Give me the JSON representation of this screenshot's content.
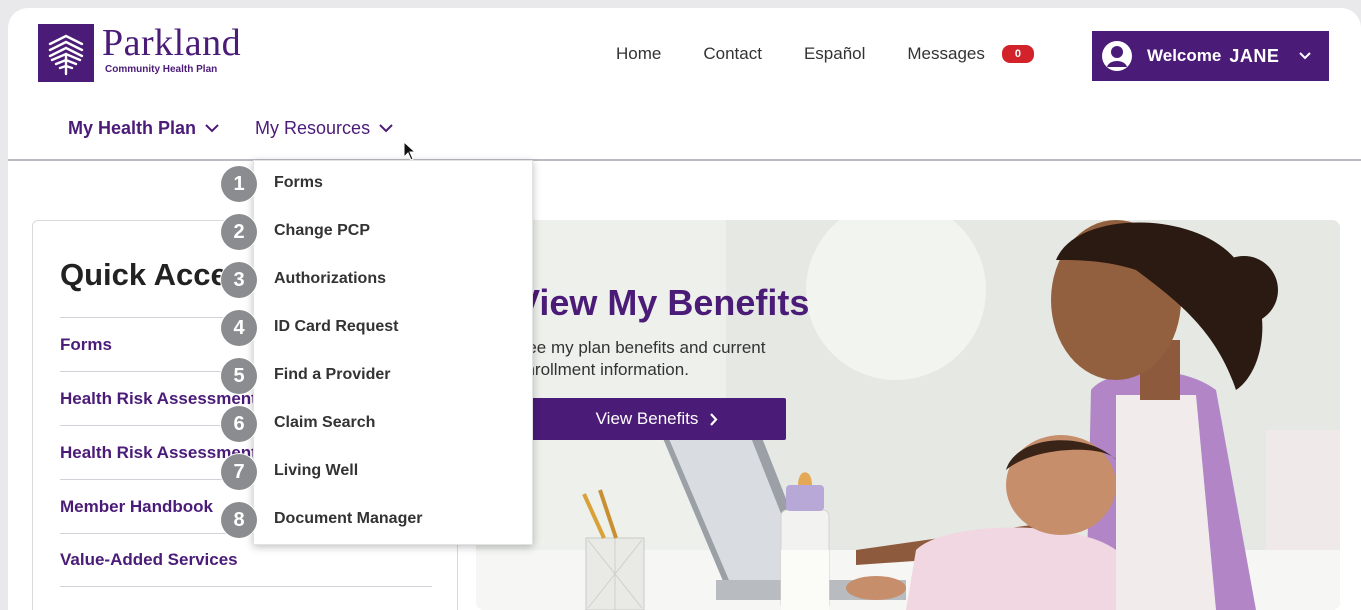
{
  "brand": {
    "name": "Parkland",
    "tagline": "Community Health Plan",
    "primary_color": "#4b1b78",
    "logo_icon": "parkland-logo-icon"
  },
  "topnav": {
    "home": "Home",
    "contact": "Contact",
    "espanol": "Español",
    "messages": "Messages",
    "messages_count": "0",
    "badge_color": "#d2232a"
  },
  "user": {
    "welcome_label": "Welcome",
    "name": "JANE",
    "avatar_icon": "user-avatar-icon"
  },
  "subnav": {
    "my_health_plan": "My Health Plan",
    "my_resources": "My Resources"
  },
  "dropdown": {
    "items": [
      {
        "num": "1",
        "label": "Forms"
      },
      {
        "num": "2",
        "label": "Change PCP"
      },
      {
        "num": "3",
        "label": "Authorizations"
      },
      {
        "num": "4",
        "label": "ID Card Request"
      },
      {
        "num": "5",
        "label": "Find a Provider"
      },
      {
        "num": "6",
        "label": "Claim Search"
      },
      {
        "num": "7",
        "label": "Living Well"
      },
      {
        "num": "8",
        "label": "Document Manager"
      }
    ]
  },
  "quick_access": {
    "title": "Quick Access",
    "links": [
      "Forms",
      "Health Risk Assessment",
      "Health Risk Assessment",
      "Member Handbook",
      "Value-Added Services"
    ]
  },
  "hero": {
    "title": "View My Benefits",
    "text": "See my plan benefits and current enrollment information.",
    "button": "View Benefits"
  }
}
